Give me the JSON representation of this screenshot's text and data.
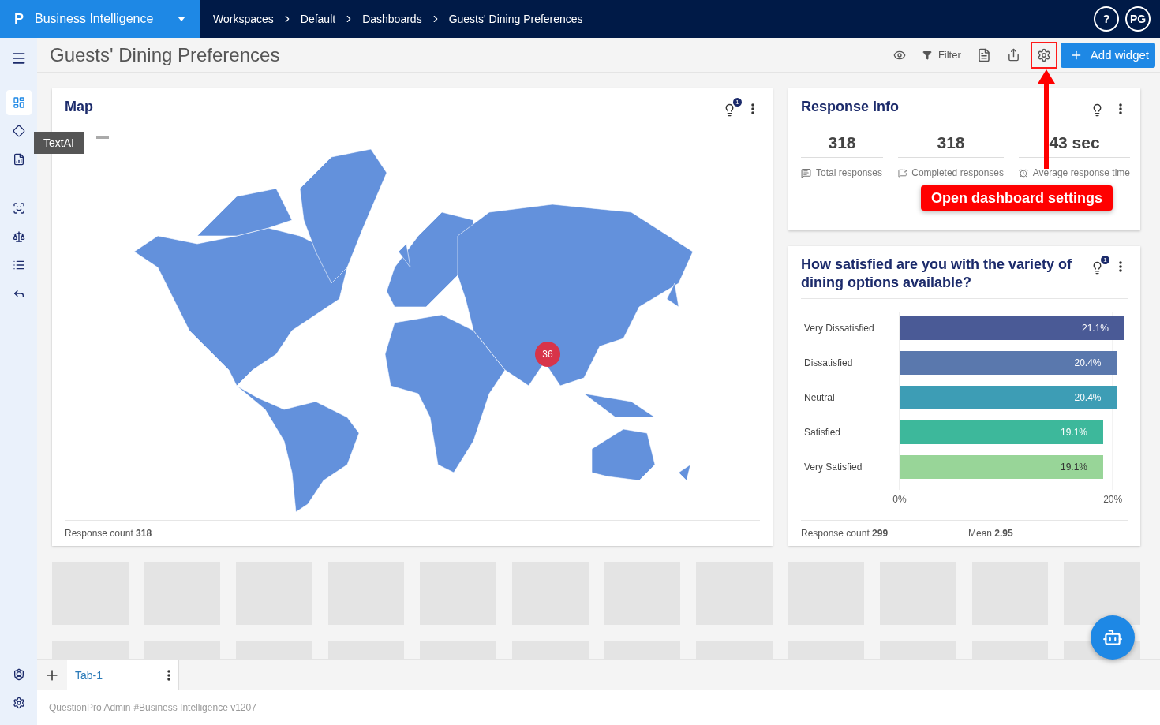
{
  "app": {
    "logo": "P",
    "brand": "Business Intelligence",
    "breadcrumb": [
      "Workspaces",
      "Default",
      "Dashboards",
      "Guests' Dining Preferences"
    ],
    "help": "?",
    "avatar": "PG"
  },
  "sidebar": {
    "items": [
      {
        "selected": true
      },
      {
        "selected": false
      },
      {
        "selected": false
      },
      {
        "selected": false
      },
      {
        "selected": false
      },
      {
        "selected": false
      },
      {
        "selected": false
      }
    ],
    "tooltip": "TextAI"
  },
  "header": {
    "title": "Guests' Dining Preferences",
    "filter": "Filter",
    "settings_highlighted": true,
    "add_widget": "Add widget"
  },
  "annotation": {
    "text": "Open dashboard settings"
  },
  "map_widget": {
    "title": "Map",
    "insight_badge": "1",
    "marker": "36",
    "footer": "Response count **318**"
  },
  "response_info": {
    "title": "Response Info",
    "stats": [
      {
        "value": "318",
        "label": "Total responses",
        "kind": "total"
      },
      {
        "value": "318",
        "label": "Completed responses",
        "kind": "completed"
      },
      {
        "value": "43 sec",
        "label": "Average response time",
        "kind": "time"
      }
    ]
  },
  "question_widget": {
    "title": "How satisfied are you with the variety of dining options available?",
    "insight_badge": "1",
    "chart_data": {
      "type": "bar",
      "orientation": "horizontal",
      "categories": [
        "Very Dissatisfied",
        "Dissatisfied",
        "Neutral",
        "Satisfied",
        "Very Satisfied"
      ],
      "values": [
        21.1,
        20.4,
        20.4,
        19.1,
        19.1
      ],
      "colors": [
        "#4a5a96",
        "#5a78ad",
        "#3d9db5",
        "#3db89b",
        "#98d598"
      ],
      "value_labels": [
        "21.1%",
        "20.4%",
        "20.4%",
        "19.1%",
        "19.1%"
      ],
      "xlim": [
        0,
        21.1
      ],
      "xticks": [
        {
          "value": 0,
          "label": "0%"
        },
        {
          "value": 20,
          "label": "20%"
        }
      ]
    },
    "footer": [
      "Response count **299**",
      "Mean **2.95**"
    ]
  },
  "tabs": [
    {
      "label": "Tab-1",
      "selected": true
    }
  ],
  "footer": {
    "text": "QuestionPro Admin",
    "link": "#Business Intelligence v1207"
  }
}
